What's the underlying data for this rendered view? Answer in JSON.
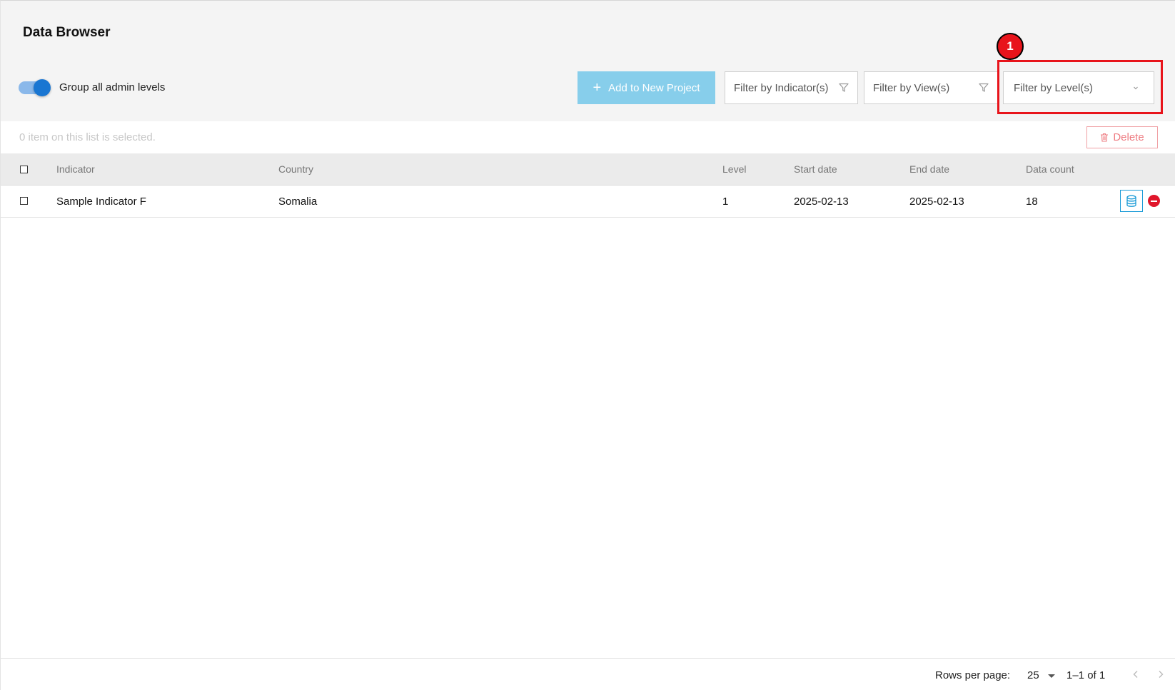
{
  "header": {
    "title": "Data Browser",
    "toggle": {
      "label": "Group all admin levels",
      "checked": true
    },
    "add_button": {
      "icon": "plus-icon",
      "label": "Add to New Project"
    },
    "filters": {
      "indicator": {
        "placeholder": "Filter by Indicator(s)",
        "icon": "funnel-icon"
      },
      "view": {
        "placeholder": "Filter by View(s)",
        "icon": "funnel-icon"
      },
      "level": {
        "placeholder": "Filter by Level(s)",
        "icon": "chevron-down-icon"
      }
    }
  },
  "annotation": {
    "badge": "1",
    "color": "#e8141b"
  },
  "selection": {
    "text": "0 item on this list is selected.",
    "delete_label": "Delete",
    "delete_icon": "trash-icon"
  },
  "table": {
    "columns": [
      "Indicator",
      "Country",
      "Level",
      "Start date",
      "End date",
      "Data count"
    ],
    "rows": [
      {
        "indicator": "Sample Indicator F",
        "country": "Somalia",
        "level": "1",
        "start_date": "2025-02-13",
        "end_date": "2025-02-13",
        "data_count": "18",
        "actions": [
          "database-icon",
          "remove-icon"
        ]
      }
    ]
  },
  "pagination": {
    "rows_per_page_label": "Rows per page:",
    "rows_per_page": "25",
    "range": "1–1 of 1"
  },
  "colors": {
    "accent": "#1976d2",
    "add_button": "#87ceeb",
    "danger": "#e0162b",
    "header_bg": "#f4f4f4"
  }
}
